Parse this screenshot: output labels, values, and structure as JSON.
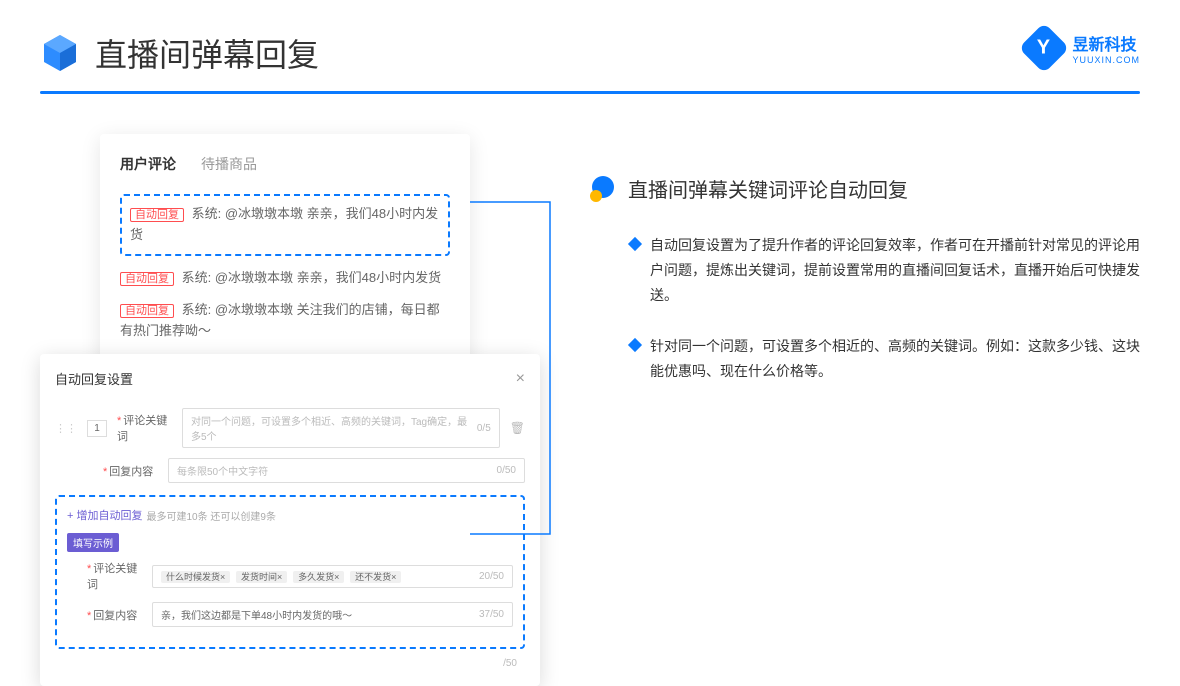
{
  "header": {
    "title": "直播间弹幕回复"
  },
  "brand": {
    "name": "昱新科技",
    "sub": "YUUXIN.COM"
  },
  "card1": {
    "tab1": "用户评论",
    "tab2": "待播商品",
    "c1_tag": "自动回复",
    "c1_text": "系统: @冰墩墩本墩 亲亲，我们48小时内发货",
    "c2_tag": "自动回复",
    "c2_text": "系统: @冰墩墩本墩 亲亲，我们48小时内发货",
    "c3_tag": "自动回复",
    "c3_text": "系统: @冰墩墩本墩 关注我们的店铺，每日都有热门推荐呦～"
  },
  "card2": {
    "title": "自动回复设置",
    "num": "1",
    "label1": "评论关键词",
    "placeholder1": "对同一个问题，可设置多个相近、高频的关键词，Tag确定，最多5个",
    "cnt1": "0/5",
    "label2": "回复内容",
    "placeholder2": "每条限50个中文字符",
    "cnt2": "0/50",
    "addlink": "+ 增加自动回复",
    "addhint": "最多可建10条 还可以创建9条",
    "example": "填写示例",
    "exlabel1": "评论关键词",
    "tag1": "什么时候发货×",
    "tag2": "发货时间×",
    "tag3": "多久发货×",
    "tag4": "还不发货×",
    "excnt1": "20/50",
    "exlabel2": "回复内容",
    "exval2": "亲，我们这边都是下单48小时内发货的哦～",
    "excnt2": "37/50",
    "cnt3": "/50"
  },
  "right": {
    "title": "直播间弹幕关键词评论自动回复",
    "b1": "自动回复设置为了提升作者的评论回复效率，作者可在开播前针对常见的评论用户问题，提炼出关键词，提前设置常用的直播间回复话术，直播开始后可快捷发送。",
    "b2": "针对同一个问题，可设置多个相近的、高频的关键词。例如：这款多少钱、这块能优惠吗、现在什么价格等。"
  }
}
